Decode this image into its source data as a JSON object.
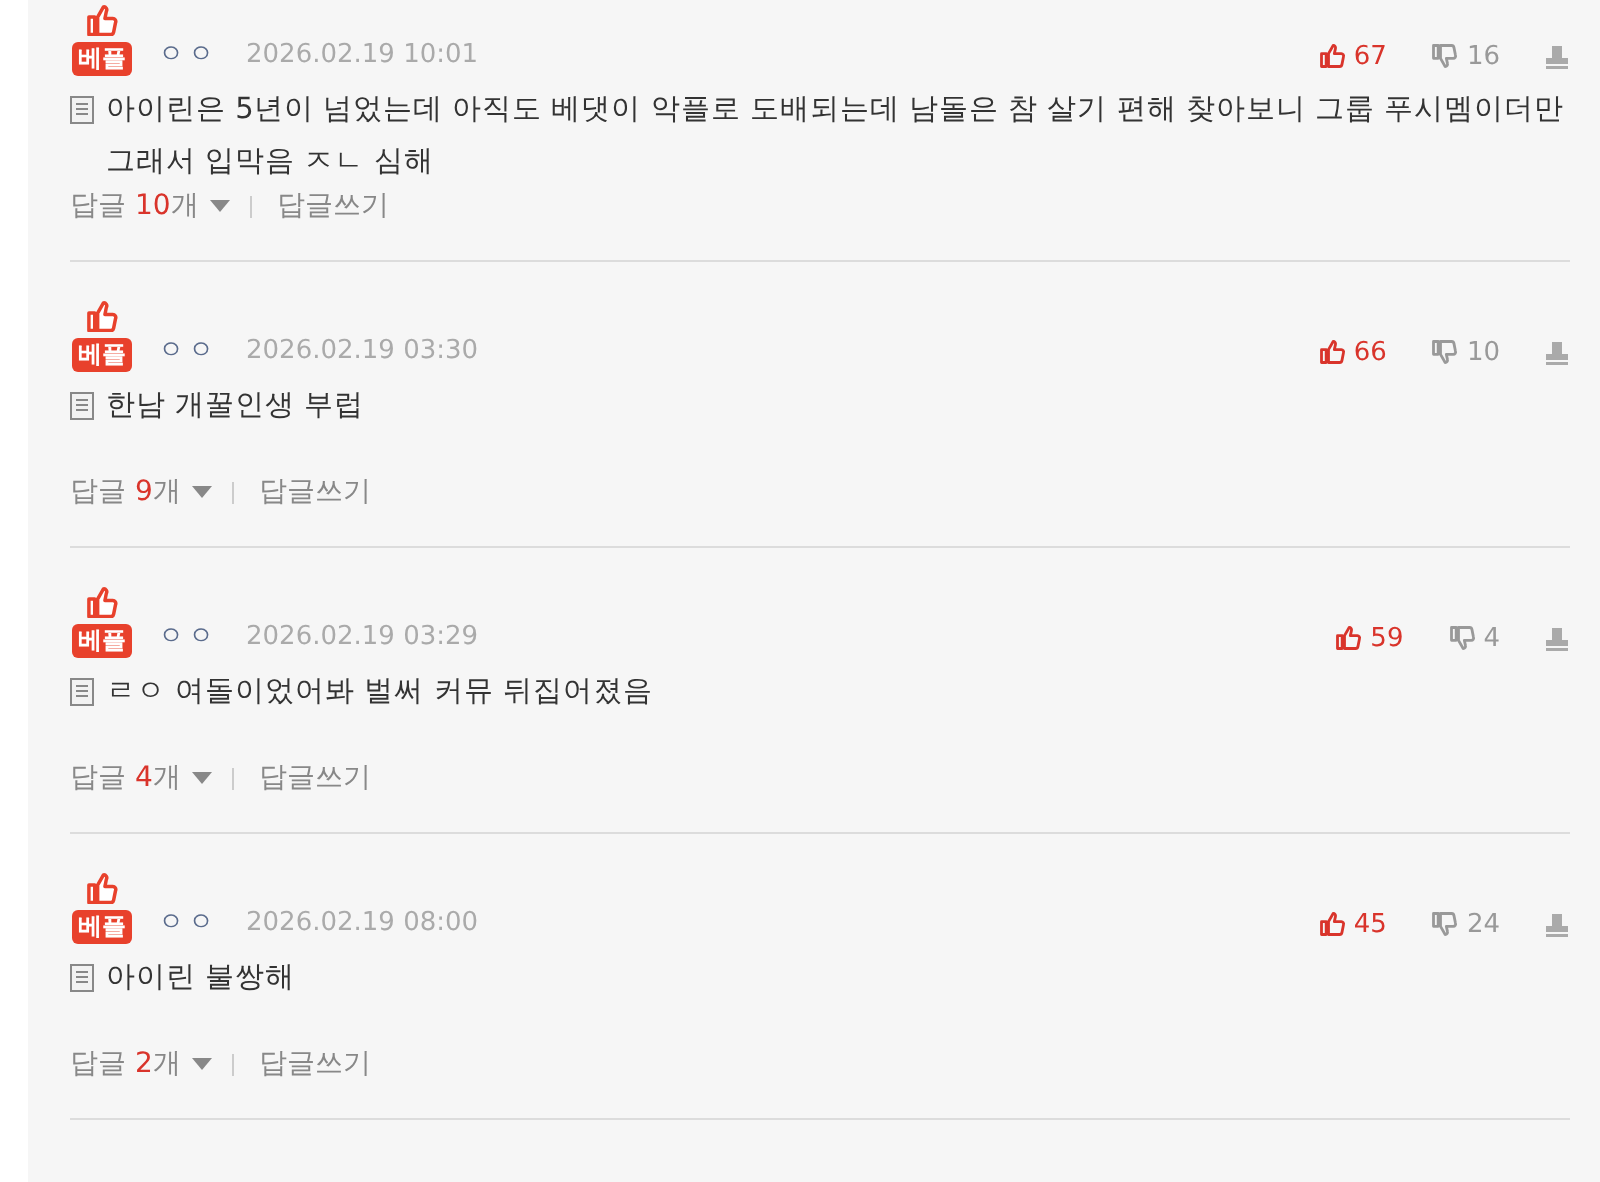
{
  "comments": [
    {
      "badge": "베플",
      "author": "ㅇㅇ",
      "date": "2026.02.19 10:01",
      "likes": "67",
      "dislikes": "16",
      "text": "아이린은 5년이 넘었는데 아직도 베댓이 악플로 도배되는데 남돌은 참 살기 편해 찾아보니 그룹 푸시멤이더만 그래서 입막음 ㅈㄴ 심해",
      "replies": {
        "label": "답글",
        "count": "10",
        "unit": "개"
      },
      "write": "답글쓰기"
    },
    {
      "badge": "베플",
      "author": "ㅇㅇ",
      "date": "2026.02.19 03:30",
      "likes": "66",
      "dislikes": "10",
      "text": "한남 개꿀인생 부럽",
      "replies": {
        "label": "답글",
        "count": "9",
        "unit": "개"
      },
      "write": "답글쓰기"
    },
    {
      "badge": "베플",
      "author": "ㅇㅇ",
      "date": "2026.02.19 03:29",
      "likes": "59",
      "dislikes": "4",
      "text": "ㄹㅇ 여돌이었어봐 벌써 커뮤 뒤집어졌음",
      "replies": {
        "label": "답글",
        "count": "4",
        "unit": "개"
      },
      "write": "답글쓰기"
    },
    {
      "badge": "베플",
      "author": "ㅇㅇ",
      "date": "2026.02.19 08:00",
      "likes": "45",
      "dislikes": "24",
      "text": "아이린 불쌍해",
      "replies": {
        "label": "답글",
        "count": "2",
        "unit": "개"
      },
      "write": "답글쓰기"
    }
  ]
}
